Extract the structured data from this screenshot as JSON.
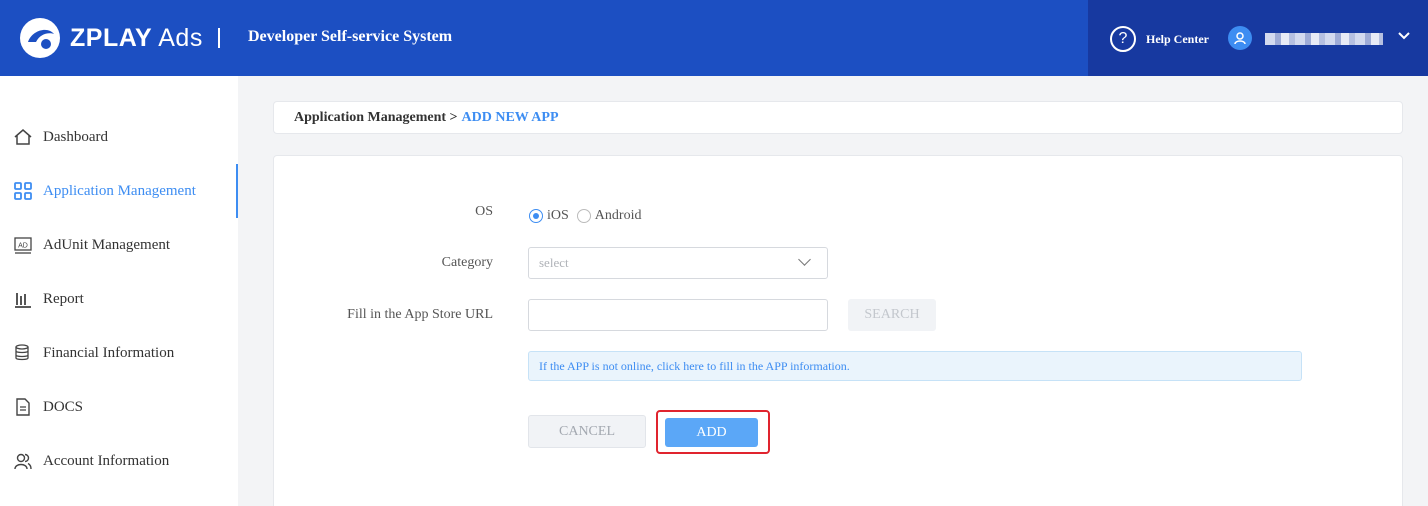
{
  "header": {
    "logo_text": "ZPLAY",
    "logo_suffix": "Ads",
    "system_title": "Developer Self-service System",
    "help_label": "Help Center",
    "help_icon": "question-circle-icon",
    "user_icon": "user-icon",
    "user_chevron": "chevron-down-icon",
    "colors": {
      "bar": "#1c4fc2",
      "right_zone": "#1739a0"
    }
  },
  "sidebar": {
    "items": [
      {
        "label": "Dashboard",
        "icon": "home-icon"
      },
      {
        "label": "Application Management",
        "icon": "grid-icon",
        "active": true
      },
      {
        "label": "AdUnit Management",
        "icon": "ad-icon"
      },
      {
        "label": "Report",
        "icon": "bar-chart-icon"
      },
      {
        "label": "Financial Information",
        "icon": "coins-icon"
      },
      {
        "label": "DOCS",
        "icon": "document-icon"
      },
      {
        "label": "Account Information",
        "icon": "users-icon"
      }
    ],
    "accent": "#3d8df2"
  },
  "breadcrumb": {
    "parent": "Application Management >",
    "current": "ADD NEW APP"
  },
  "form": {
    "os_label": "OS",
    "os_options": [
      "iOS",
      "Android"
    ],
    "os_selected": "iOS",
    "category_label": "Category",
    "category_placeholder": "select",
    "url_label": "Fill in the App Store URL",
    "url_value": "",
    "search_label": "SEARCH",
    "notice": "If the APP is not online, click here to fill in the APP information.",
    "cancel_label": "CANCEL",
    "add_label": "ADD"
  }
}
